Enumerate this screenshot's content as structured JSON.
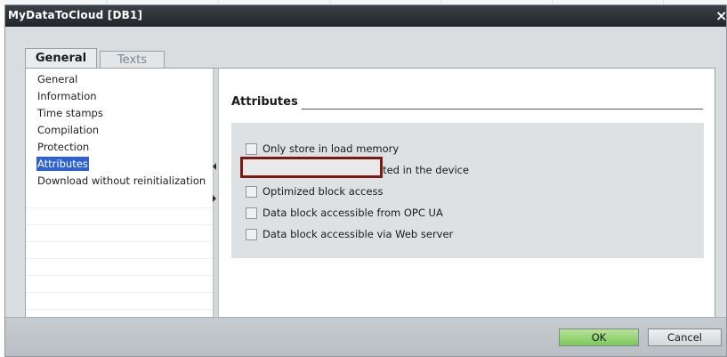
{
  "window": {
    "title": "MyDataToCloud [DB1]",
    "close_glyph": "×"
  },
  "tabs": [
    {
      "label": "General",
      "selected": true
    },
    {
      "label": "Texts",
      "selected": false
    }
  ],
  "nav": {
    "items": [
      {
        "label": "General",
        "selected": false
      },
      {
        "label": "Information",
        "selected": false
      },
      {
        "label": "Time stamps",
        "selected": false
      },
      {
        "label": "Compilation",
        "selected": false
      },
      {
        "label": "Protection",
        "selected": false
      },
      {
        "label": "Attributes",
        "selected": true
      },
      {
        "label": "Download without reinitialization",
        "selected": false
      }
    ]
  },
  "attributes": {
    "section_title": "Attributes",
    "options": [
      {
        "label": "Only store in load memory",
        "checked": false
      },
      {
        "label": "Data block write-protected in the device",
        "checked": false
      },
      {
        "label": "Optimized block access",
        "checked": false,
        "highlighted": true
      },
      {
        "label": "Data block accessible from OPC UA",
        "checked": false
      },
      {
        "label": "Data block accessible via Web server",
        "checked": false
      }
    ]
  },
  "footer": {
    "ok_label": "OK",
    "cancel_label": "Cancel"
  },
  "colors": {
    "titlebar": "#2b3035",
    "selection": "#2f62d1",
    "highlight_border": "#7a1a10",
    "ok_button": "#8fd36c"
  }
}
